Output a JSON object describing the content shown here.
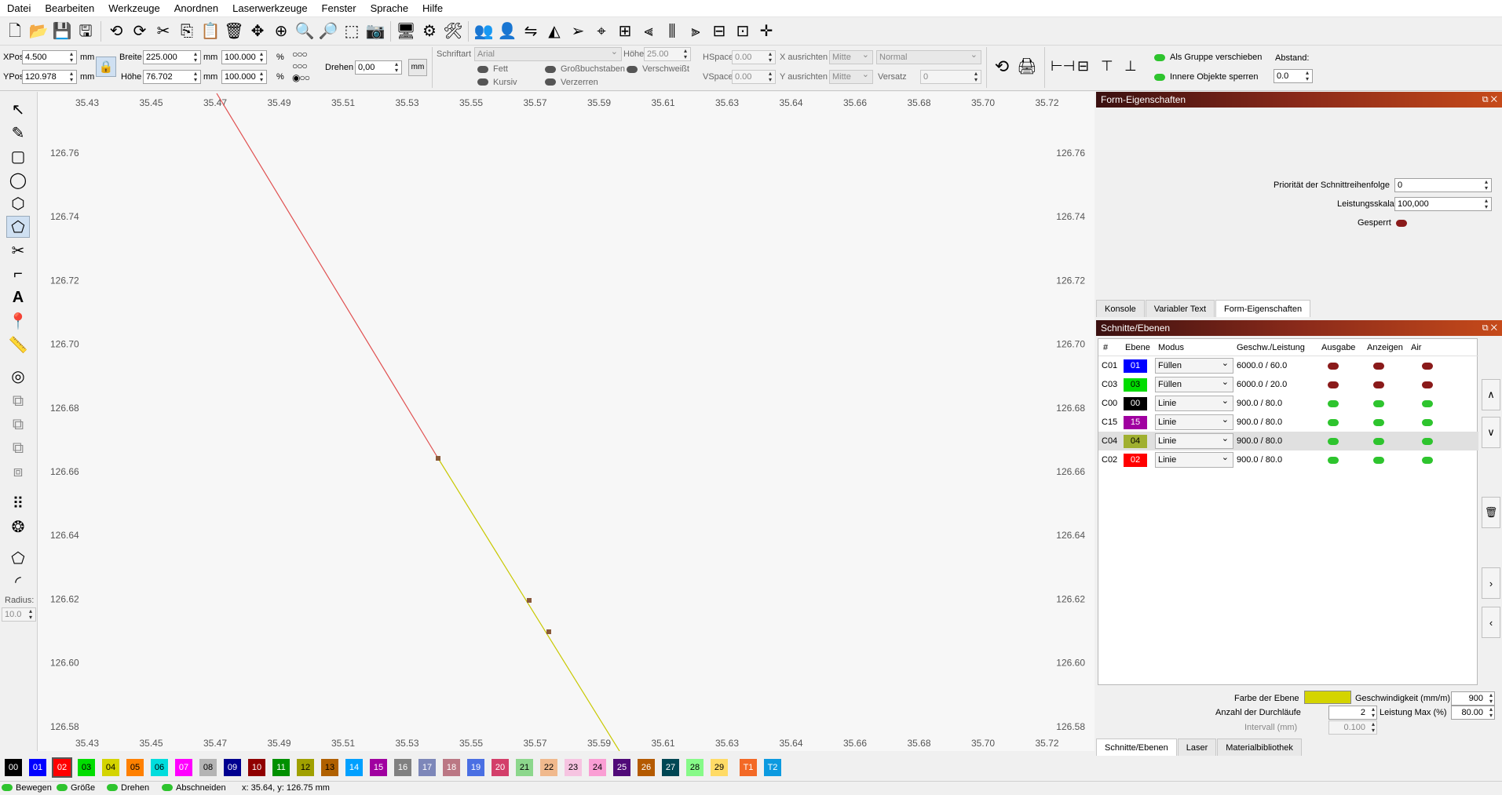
{
  "menu": [
    "Datei",
    "Bearbeiten",
    "Werkzeuge",
    "Anordnen",
    "Laserwerkzeuge",
    "Fenster",
    "Sprache",
    "Hilfe"
  ],
  "pos": {
    "xpos_label": "XPos",
    "xpos": "4.500",
    "ypos_label": "YPos",
    "ypos": "120.978",
    "unit": "mm",
    "width_label": "Breite",
    "width": "225.000",
    "height_label": "Höhe",
    "height": "76.702",
    "scale_w": "100.000",
    "scale_h": "100.000",
    "percent": "%",
    "rotate_label": "Drehen",
    "rotate": "0,00",
    "mm_button": "mm"
  },
  "text": {
    "font_label": "Schriftart",
    "font": "Arial",
    "height_label": "Höhe",
    "height": "25.00",
    "hspace_label": "HSpace",
    "hspace": "0.00",
    "vspace_label": "VSpace",
    "vspace": "0.00",
    "xalign_label": "X ausrichten",
    "xalign": "Mitte",
    "yalign_label": "Y ausrichten",
    "yalign": "Mitte",
    "style": "Normal",
    "offset_label": "Versatz",
    "offset": "0",
    "bold": "Fett",
    "italic": "Kursiv",
    "upper": "Großbuchstaben",
    "distort": "Verzerren",
    "welded": "Verschweißt"
  },
  "group": {
    "move_group": "Als Gruppe verschieben",
    "lock_inner": "Innere Objekte sperren",
    "spacing_label": "Abstand:",
    "spacing": "0.0"
  },
  "ruler": {
    "x_ticks": [
      "35.43",
      "35.45",
      "35.47",
      "35.49",
      "35.51",
      "35.53",
      "35.55",
      "35.57",
      "35.59",
      "35.61",
      "35.63",
      "35.64",
      "35.66",
      "35.68",
      "35.70",
      "35.72"
    ],
    "y_ticks": [
      "126.76",
      "126.74",
      "126.72",
      "126.70",
      "126.68",
      "126.66",
      "126.64",
      "126.62",
      "126.60",
      "126.58"
    ]
  },
  "left_panel": {
    "radius_label": "Radius:",
    "radius": "10.0"
  },
  "shape_props": {
    "title": "Form-Eigenschaften",
    "priority_label": "Priorität der Schnittreihenfolge",
    "priority": "0",
    "power_label": "Leistungsskala",
    "power": "100,000",
    "locked_label": "Gesperrt"
  },
  "top_tabs": [
    "Konsole",
    "Variabler Text",
    "Form-Eigenschaften"
  ],
  "layers_panel": {
    "title": "Schnitte/Ebenen",
    "headers": [
      "#",
      "Ebene",
      "Modus",
      "Geschw./Leistung",
      "Ausgabe",
      "Anzeigen",
      "Air"
    ],
    "rows": [
      {
        "id": "C01",
        "layer": "01",
        "color": "#0000ff",
        "text_color": "#ffffff",
        "mode": "Füllen",
        "speed": "6000.0 / 60.0",
        "out": "off",
        "show": "off",
        "air": "off"
      },
      {
        "id": "C03",
        "layer": "03",
        "color": "#00dd00",
        "text_color": "#000000",
        "mode": "Füllen",
        "speed": "6000.0 / 20.0",
        "out": "off",
        "show": "off",
        "air": "off"
      },
      {
        "id": "C00",
        "layer": "00",
        "color": "#000000",
        "text_color": "#ffffff",
        "mode": "Linie",
        "speed": "900.0 / 80.0",
        "out": "on",
        "show": "on",
        "air": "on"
      },
      {
        "id": "C15",
        "layer": "15",
        "color": "#a000a0",
        "text_color": "#ffffff",
        "mode": "Linie",
        "speed": "900.0 / 80.0",
        "out": "on",
        "show": "on",
        "air": "on"
      },
      {
        "id": "C04",
        "layer": "04",
        "color": "#a0b030",
        "text_color": "#000000",
        "mode": "Linie",
        "speed": "900.0 / 80.0",
        "out": "on",
        "show": "on",
        "air": "on"
      },
      {
        "id": "C02",
        "layer": "02",
        "color": "#ff0000",
        "text_color": "#ffffff",
        "mode": "Linie",
        "speed": "900.0 / 80.0",
        "out": "on",
        "show": "on",
        "air": "on"
      }
    ],
    "selected_index": 4,
    "layer_color_label": "Farbe der Ebene",
    "layer_color": "#d4d400",
    "speed_label": "Geschwindigkeit (mm/m)",
    "speed": "900",
    "passes_label": "Anzahl der Durchläufe",
    "passes": "2",
    "power_max_label": "Leistung Max (%)",
    "power_max": "80.00",
    "interval_label": "Intervall (mm)",
    "interval": "0.100"
  },
  "bottom_tabs": [
    "Schnitte/Ebenen",
    "Laser",
    "Materialbibliothek"
  ],
  "palette": [
    {
      "l": "00",
      "c": "#000000",
      "t": "#fff"
    },
    {
      "l": "01",
      "c": "#0000ff",
      "t": "#fff"
    },
    {
      "l": "02",
      "c": "#ff0000",
      "t": "#fff"
    },
    {
      "l": "03",
      "c": "#00dd00",
      "t": "#000"
    },
    {
      "l": "04",
      "c": "#d4d400",
      "t": "#000"
    },
    {
      "l": "05",
      "c": "#ff8000",
      "t": "#000"
    },
    {
      "l": "06",
      "c": "#00dddd",
      "t": "#000"
    },
    {
      "l": "07",
      "c": "#ff00ff",
      "t": "#fff"
    },
    {
      "l": "08",
      "c": "#b4b4b4",
      "t": "#000"
    },
    {
      "l": "09",
      "c": "#000090",
      "t": "#fff"
    },
    {
      "l": "10",
      "c": "#900000",
      "t": "#fff"
    },
    {
      "l": "11",
      "c": "#009000",
      "t": "#fff"
    },
    {
      "l": "12",
      "c": "#a0a000",
      "t": "#000"
    },
    {
      "l": "13",
      "c": "#b06000",
      "t": "#000"
    },
    {
      "l": "14",
      "c": "#00a0ff",
      "t": "#fff"
    },
    {
      "l": "15",
      "c": "#a000a0",
      "t": "#fff"
    },
    {
      "l": "16",
      "c": "#808080",
      "t": "#fff"
    },
    {
      "l": "17",
      "c": "#7d87b9",
      "t": "#fff"
    },
    {
      "l": "18",
      "c": "#bb7784",
      "t": "#fff"
    },
    {
      "l": "19",
      "c": "#4a6fe3",
      "t": "#fff"
    },
    {
      "l": "20",
      "c": "#d33f6a",
      "t": "#fff"
    },
    {
      "l": "21",
      "c": "#8cd78c",
      "t": "#000"
    },
    {
      "l": "22",
      "c": "#f0b98d",
      "t": "#000"
    },
    {
      "l": "23",
      "c": "#f6c4e1",
      "t": "#000"
    },
    {
      "l": "24",
      "c": "#fa9ed4",
      "t": "#000"
    },
    {
      "l": "25",
      "c": "#500a78",
      "t": "#fff"
    },
    {
      "l": "26",
      "c": "#b45a00",
      "t": "#fff"
    },
    {
      "l": "27",
      "c": "#004754",
      "t": "#fff"
    },
    {
      "l": "28",
      "c": "#86fa88",
      "t": "#000"
    },
    {
      "l": "29",
      "c": "#ffdb66",
      "t": "#000"
    },
    {
      "l": "T1",
      "c": "#f36926",
      "t": "#fff"
    },
    {
      "l": "T2",
      "c": "#0c9ae0",
      "t": "#fff"
    }
  ],
  "status": {
    "move": "Bewegen",
    "size": "Größe",
    "rotate": "Drehen",
    "cut": "Abschneiden",
    "coords": "x: 35.64, y: 126.75 mm"
  }
}
